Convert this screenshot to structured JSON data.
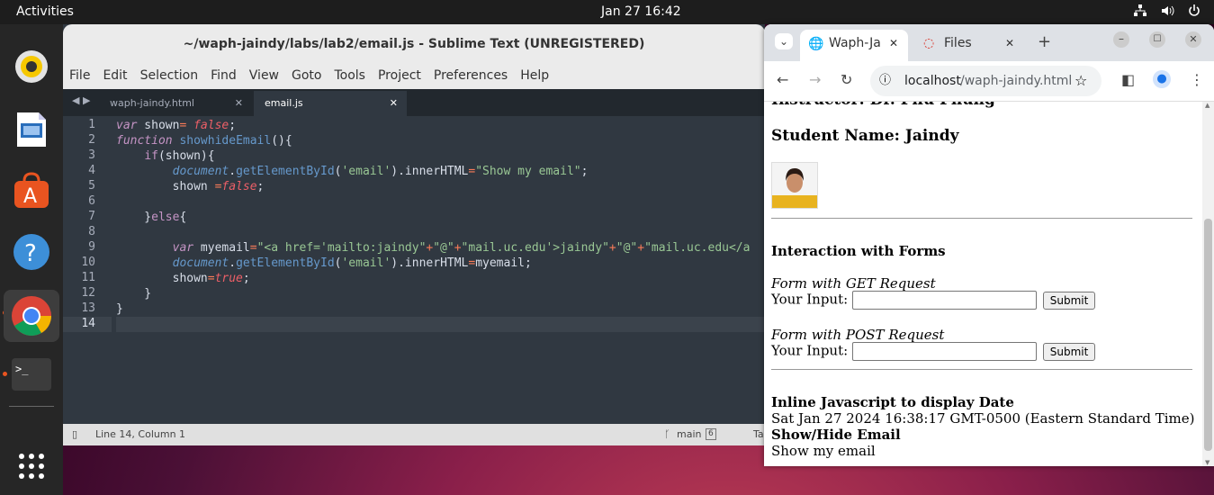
{
  "topbar": {
    "activities": "Activities",
    "clock": "Jan 27  16:42"
  },
  "dock": {
    "items": [
      "rhythmbox-icon",
      "libreoffice-impress-icon",
      "app-center-icon",
      "help-icon",
      "chrome-icon",
      "terminal-icon",
      "app-grid-icon"
    ]
  },
  "sublime": {
    "title": "~/waph-jaindy/labs/lab2/email.js - Sublime Text (UNREGISTERED)",
    "menu": [
      "File",
      "Edit",
      "Selection",
      "Find",
      "View",
      "Goto",
      "Tools",
      "Project",
      "Preferences",
      "Help"
    ],
    "tabs": [
      {
        "label": "waph-jaindy.html",
        "active": false
      },
      {
        "label": "email.js",
        "active": true
      }
    ],
    "line_numbers": [
      "1",
      "2",
      "3",
      "4",
      "5",
      "6",
      "7",
      "8",
      "9",
      "10",
      "11",
      "12",
      "13",
      "14"
    ],
    "status": {
      "position": "Line 14, Column 1",
      "branch": "main",
      "branch_count": "6",
      "tab_hint": "Ta"
    }
  },
  "chrome": {
    "tabs": [
      {
        "label": "Waph-Ja",
        "active": true
      },
      {
        "label": "Files",
        "active": false
      }
    ],
    "url_host": "localhost",
    "url_path": "/waph-jaindy.html",
    "page": {
      "instructor_partial": "Instructor: Dr. Phu Phung",
      "student_name": "Student Name: Jaindy",
      "interaction_heading": "Interaction with Forms",
      "get_form_label": "Form with GET Request",
      "get_input_label": "Your Input:",
      "get_submit": "Submit",
      "post_form_label": "Form with POST Request",
      "post_input_label": "Your Input:",
      "post_submit": "Submit",
      "inline_js_heading": "Inline Javascript to display Date",
      "date_text": "Sat Jan 27 2024 16:38:17 GMT-0500 (Eastern Standard Time)",
      "showhide_heading": "Show/Hide Email",
      "email_text": "Show my email"
    }
  }
}
